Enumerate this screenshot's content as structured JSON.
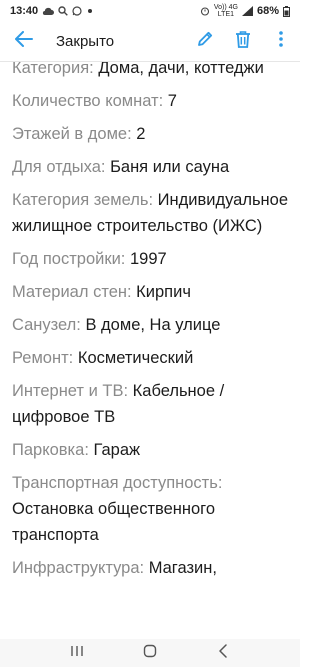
{
  "status_bar": {
    "time": "13:40",
    "network_top": "Vo)) 4G",
    "network_bottom": "LTE1",
    "battery": "68%"
  },
  "app_bar": {
    "title": "Закрыто",
    "back_icon": "arrow-left-icon",
    "edit_icon": "pencil-icon",
    "delete_icon": "trash-icon",
    "more_icon": "more-vertical-icon",
    "accent_color": "#2f9be6"
  },
  "properties": [
    {
      "label": "Категория:",
      "value": "Дома, дачи, коттеджи"
    },
    {
      "label": "Количество комнат:",
      "value": "7"
    },
    {
      "label": "Этажей в доме:",
      "value": "2"
    },
    {
      "label": "Для отдыха:",
      "value": "Баня или сауна"
    },
    {
      "label": "Категория земель:",
      "value": "Индивидуальное жилищное строительство (ИЖС)"
    },
    {
      "label": "Год постройки:",
      "value": "1997"
    },
    {
      "label": "Материал стен:",
      "value": "Кирпич"
    },
    {
      "label": "Санузел:",
      "value": "В доме, На улице"
    },
    {
      "label": "Ремонт:",
      "value": "Косметический"
    },
    {
      "label": "Интернет и ТВ:",
      "value": "Кабельное / цифровое ТВ"
    },
    {
      "label": "Парковка:",
      "value": "Гараж"
    },
    {
      "label": "Транспортная доступность:",
      "value": "Остановка общественного транспорта"
    },
    {
      "label": "Инфраструктура:",
      "value": "Магазин,"
    }
  ],
  "nav_bar": {
    "recents_icon": "recent-apps-icon",
    "home_icon": "home-icon",
    "back_icon": "nav-back-icon"
  }
}
